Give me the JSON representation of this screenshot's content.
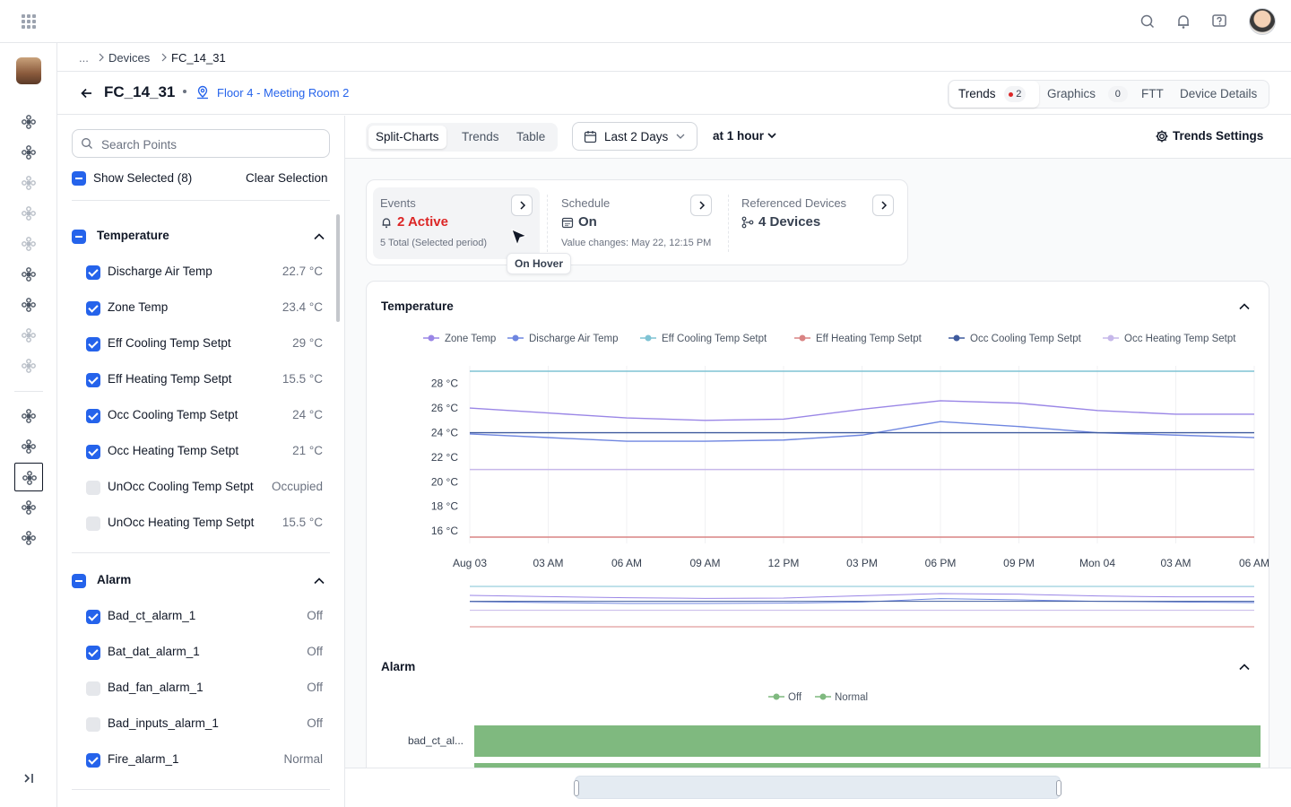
{
  "breadcrumb": {
    "ellipsis": "...",
    "items": [
      "Devices",
      "FC_14_31"
    ]
  },
  "device": {
    "name": "FC_14_31",
    "location": "Floor 4 - Meeting Room 2"
  },
  "top_tabs": [
    {
      "label": "Trends",
      "badge": "2",
      "active": true
    },
    {
      "label": "Graphics",
      "badge": "0"
    },
    {
      "label": "FTT"
    },
    {
      "label": "Device Details"
    }
  ],
  "search": {
    "placeholder": "Search Points",
    "value": ""
  },
  "selection": {
    "show_selected": "Show Selected (8)",
    "clear": "Clear Selection"
  },
  "groups": [
    {
      "title": "Temperature",
      "points": [
        {
          "name": "Discharge Air Temp",
          "value": "22.7 °C",
          "checked": true
        },
        {
          "name": "Zone Temp",
          "value": "23.4 °C",
          "checked": true
        },
        {
          "name": "Eff Cooling Temp Setpt",
          "value": "29 °C",
          "checked": true
        },
        {
          "name": "Eff Heating Temp Setpt",
          "value": "15.5 °C",
          "checked": true
        },
        {
          "name": "Occ Cooling Temp Setpt",
          "value": "24 °C",
          "checked": true
        },
        {
          "name": "Occ Heating Temp Setpt",
          "value": "21 °C",
          "checked": true
        },
        {
          "name": "UnOcc Cooling Temp Setpt",
          "value": "Occupied",
          "checked": false
        },
        {
          "name": "UnOcc Heating Temp Setpt",
          "value": "15.5 °C",
          "checked": false
        }
      ]
    },
    {
      "title": "Alarm",
      "points": [
        {
          "name": "Bad_ct_alarm_1",
          "value": "Off",
          "checked": true
        },
        {
          "name": "Bat_dat_alarm_1",
          "value": "Off",
          "checked": true
        },
        {
          "name": "Bad_fan_alarm_1",
          "value": "Off",
          "checked": false
        },
        {
          "name": "Bad_inputs_alarm_1",
          "value": "Off",
          "checked": false
        },
        {
          "name": "Fire_alarm_1",
          "value": "Normal",
          "checked": true
        }
      ]
    }
  ],
  "view_modes": [
    "Split-Charts",
    "Trends",
    "Table"
  ],
  "active_view": "Split-Charts",
  "date_range": "Last 2 Days",
  "interval": "at 1 hour",
  "settings_label": "Trends Settings",
  "summary": {
    "events": {
      "title": "Events",
      "value": "2 Active",
      "sub": "5 Total (Selected period)"
    },
    "schedule": {
      "title": "Schedule",
      "value": "On",
      "sub": "Value changes: May 22, 12:15 PM"
    },
    "referenced": {
      "title": "Referenced Devices",
      "value": "4 Devices"
    },
    "tooltip": "On Hover"
  },
  "colors": {
    "accent": "#2563eb",
    "alert": "#dc2626",
    "alarm_green": "#7fb97f"
  },
  "chart_data": [
    {
      "type": "line",
      "title": "Temperature",
      "x": [
        "Aug 03",
        "03 AM",
        "06 AM",
        "09 AM",
        "12 PM",
        "03 PM",
        "06 PM",
        "09 PM",
        "Mon 04",
        "03 AM",
        "06 AM"
      ],
      "yticks": [
        "16 °C",
        "18 °C",
        "20 °C",
        "22 °C",
        "24 °C",
        "26 °C",
        "28 °C"
      ],
      "ylim": [
        15.5,
        29
      ],
      "legend_position": "top",
      "grid": true,
      "series": [
        {
          "name": "Zone Temp",
          "color": "#9a86e6",
          "values": [
            26.0,
            25.6,
            25.2,
            25.0,
            25.1,
            25.9,
            26.6,
            26.4,
            25.8,
            25.5,
            25.5
          ]
        },
        {
          "name": "Discharge Air Temp",
          "color": "#6f86e0",
          "values": [
            23.9,
            23.6,
            23.3,
            23.3,
            23.4,
            23.8,
            24.9,
            24.5,
            24.0,
            23.8,
            23.6
          ]
        },
        {
          "name": "Eff Cooling Temp Setpt",
          "color": "#7fc3d4",
          "values": [
            29,
            29,
            29,
            29,
            29,
            29,
            29,
            29,
            29,
            29,
            29
          ]
        },
        {
          "name": "Eff Heating Temp Setpt",
          "color": "#d98383",
          "values": [
            15.5,
            15.5,
            15.5,
            15.5,
            15.5,
            15.5,
            15.5,
            15.5,
            15.5,
            15.5,
            15.5
          ]
        },
        {
          "name": "Occ Cooling Temp Setpt",
          "color": "#3f5b9e",
          "values": [
            24,
            24,
            24,
            24,
            24,
            24,
            24,
            24,
            24,
            24,
            24
          ]
        },
        {
          "name": "Occ Heating Temp Setpt",
          "color": "#c6b8ea",
          "values": [
            21,
            21,
            21,
            21,
            21,
            21,
            21,
            21,
            21,
            21,
            21
          ]
        }
      ]
    },
    {
      "type": "bar",
      "title": "Alarm",
      "legend": [
        "Off",
        "Normal"
      ],
      "legend_colors": [
        "#7fb97f",
        "#7fb97f"
      ],
      "categories": [
        "bad_ct_al..."
      ],
      "states": [
        "Off"
      ]
    }
  ]
}
